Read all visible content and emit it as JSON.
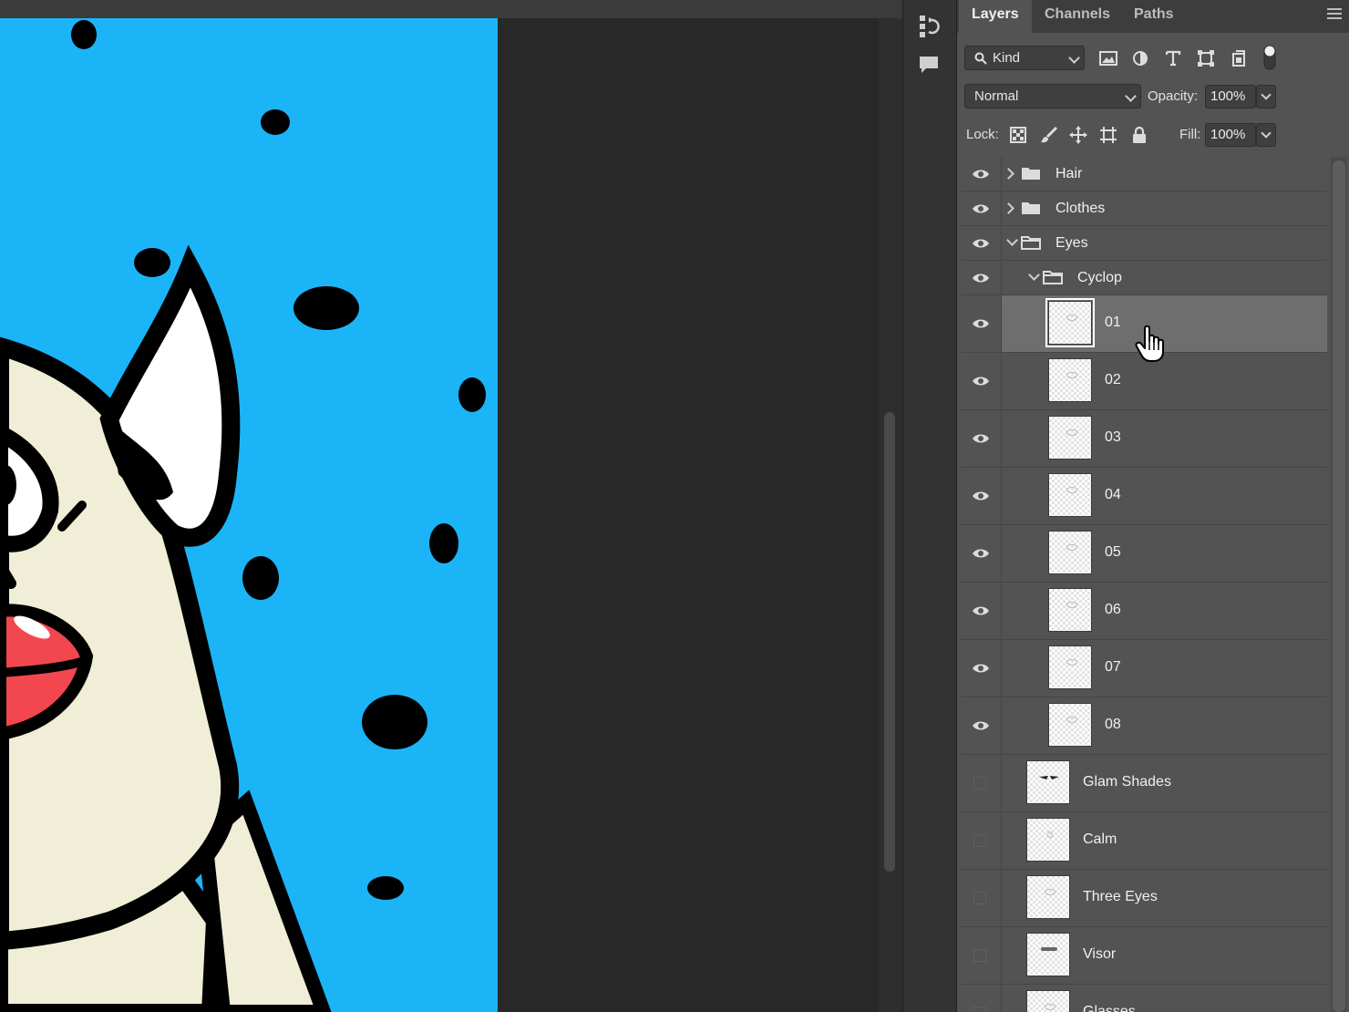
{
  "panel": {
    "tabs": [
      "Layers",
      "Channels",
      "Paths"
    ],
    "active_tab": "Layers",
    "filter": {
      "label": "Kind"
    },
    "blend_mode": "Normal",
    "opacity": {
      "label": "Opacity:",
      "value": "100%"
    },
    "lock": {
      "label": "Lock:"
    },
    "fill": {
      "label": "Fill:",
      "value": "100%"
    }
  },
  "layers": [
    {
      "name": "Hair",
      "type": "group",
      "expanded": false,
      "visible": true
    },
    {
      "name": "Clothes",
      "type": "group",
      "expanded": false,
      "visible": true
    },
    {
      "name": "Eyes",
      "type": "group",
      "expanded": true,
      "visible": true
    },
    {
      "name": "Cyclop",
      "type": "group",
      "expanded": true,
      "visible": true
    },
    {
      "name": "01",
      "type": "layer",
      "visible": true,
      "selected": true
    },
    {
      "name": "02",
      "type": "layer",
      "visible": true
    },
    {
      "name": "03",
      "type": "layer",
      "visible": true
    },
    {
      "name": "04",
      "type": "layer",
      "visible": true
    },
    {
      "name": "05",
      "type": "layer",
      "visible": true
    },
    {
      "name": "06",
      "type": "layer",
      "visible": true
    },
    {
      "name": "07",
      "type": "layer",
      "visible": true
    },
    {
      "name": "08",
      "type": "layer",
      "visible": true
    },
    {
      "name": "Glam Shades",
      "type": "layer",
      "visible": false
    },
    {
      "name": "Calm",
      "type": "layer",
      "visible": false
    },
    {
      "name": "Three Eyes",
      "type": "layer",
      "visible": false
    },
    {
      "name": "Visor",
      "type": "layer",
      "visible": false
    },
    {
      "name": "Glasses",
      "type": "layer",
      "visible": false
    }
  ],
  "colors": {
    "canvas_blue": "#1bb5f7",
    "skin": "#f0eed6",
    "lips": "#f2474f",
    "panel_bg": "#535353",
    "selected_row": "#6e6e6e"
  }
}
